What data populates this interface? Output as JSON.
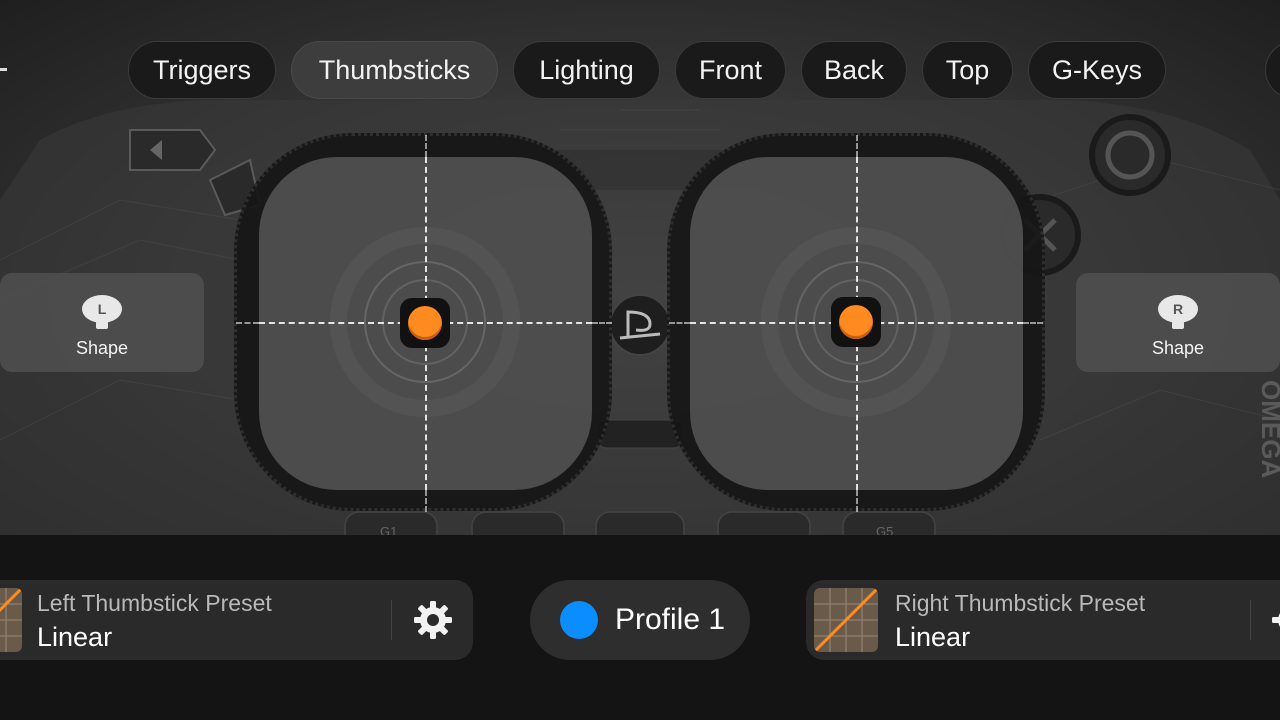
{
  "tabs": [
    {
      "label": "Triggers",
      "active": false
    },
    {
      "label": "Thumbsticks",
      "active": true
    },
    {
      "label": "Lighting",
      "active": false
    },
    {
      "label": "Front",
      "active": false
    },
    {
      "label": "Back",
      "active": false
    },
    {
      "label": "Top",
      "active": false
    },
    {
      "label": "G-Keys",
      "active": false
    }
  ],
  "left_shape": {
    "badge": "L",
    "label": "Shape"
  },
  "right_shape": {
    "badge": "R",
    "label": "Shape"
  },
  "sticks": {
    "left": {
      "x": 0,
      "y": 0
    },
    "right": {
      "x": 0,
      "y": 0
    }
  },
  "controller_labels": {
    "g1": "G1",
    "g5": "G5",
    "brand_edge": "OMEGA"
  },
  "left_preset": {
    "title": "Left Thumbstick Preset",
    "value": "Linear",
    "icon": "gear-icon"
  },
  "right_preset": {
    "title": "Right Thumbstick Preset",
    "value": "Linear"
  },
  "profile": {
    "label": "Profile 1",
    "color": "#0a8dff"
  },
  "colors": {
    "accent_orange": "#ff8a1f",
    "profile_blue": "#0a8dff"
  }
}
